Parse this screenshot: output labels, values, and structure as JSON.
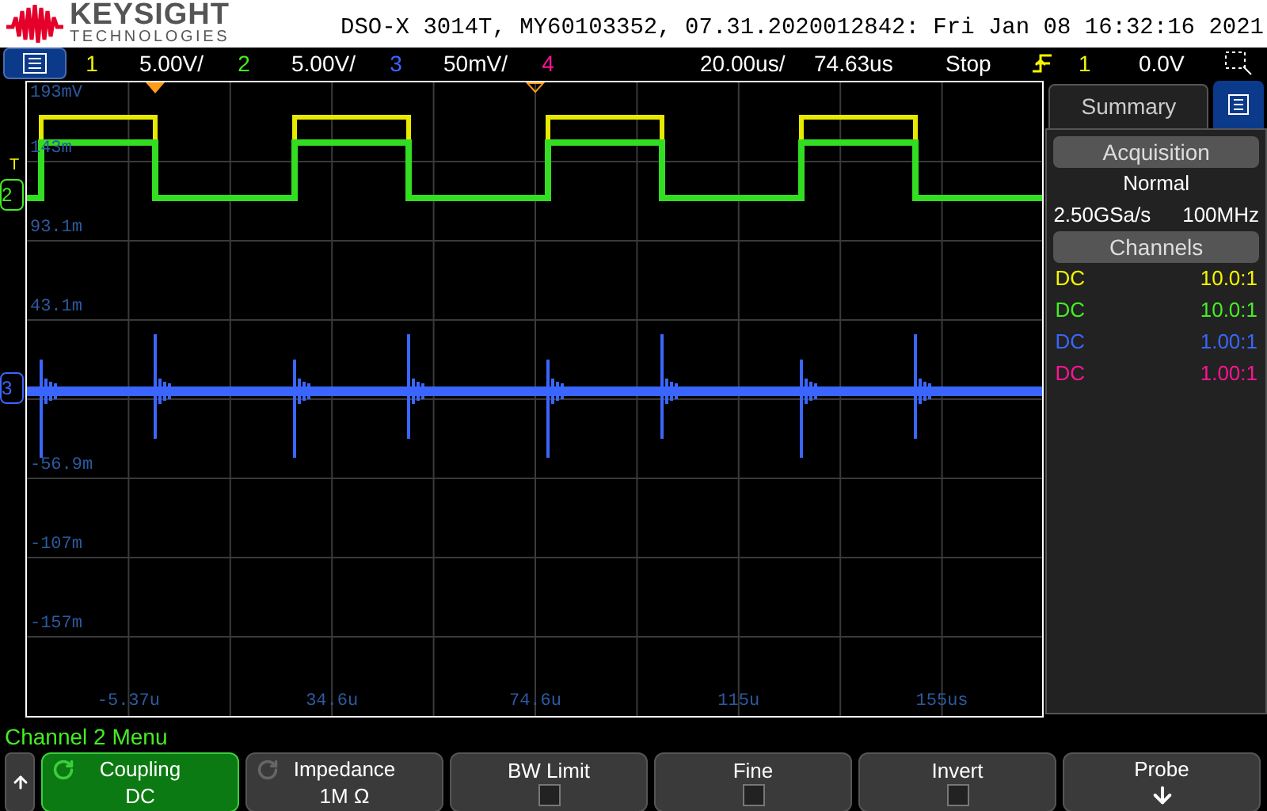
{
  "header": {
    "brand": "KEYSIGHT",
    "brand_sub": "TECHNOLOGIES",
    "title": "DSO-X 3014T, MY60103352, 07.31.2020012842: Fri Jan 08 16:32:16 2021"
  },
  "status_bar": {
    "channels": [
      {
        "number": "1",
        "scale": "5.00V/"
      },
      {
        "number": "2",
        "scale": "5.00V/"
      },
      {
        "number": "3",
        "scale": "50mV/"
      },
      {
        "number": "4"
      }
    ],
    "timebase": "20.00us/",
    "delay": "74.63us",
    "run_state": "Stop",
    "trigger": {
      "source": "1",
      "level": "0.0V"
    }
  },
  "graticule": {
    "y_labels": [
      "193mV",
      "143m",
      "93.1m",
      "43.1m",
      "-56.9m",
      "-107m",
      "-157m"
    ],
    "x_labels": [
      "-5.37u",
      "34.6u",
      "74.6u",
      "115u",
      "155us"
    ],
    "markers": [
      {
        "label": "T",
        "kind": "trigger"
      },
      {
        "label": "2",
        "kind": "channel",
        "color": "#44ee22"
      },
      {
        "label": "3",
        "kind": "channel",
        "color": "#3a66ff"
      }
    ]
  },
  "summary": {
    "tab": "Summary",
    "acquisition": {
      "heading": "Acquisition",
      "mode": "Normal",
      "sample_rate": "2.50GSa/s",
      "bandwidth": "100MHz"
    },
    "channels": {
      "heading": "Channels",
      "rows": [
        {
          "coupling": "DC",
          "probe": "10.0:1",
          "color": "#f5f500"
        },
        {
          "coupling": "DC",
          "probe": "10.0:1",
          "color": "#44ee22"
        },
        {
          "coupling": "DC",
          "probe": "1.00:1",
          "color": "#3a66ff"
        },
        {
          "coupling": "DC",
          "probe": "1.00:1",
          "color": "#ff1493"
        }
      ]
    }
  },
  "menu": {
    "title": "Channel 2 Menu",
    "softkeys": [
      {
        "kind": "knob",
        "label": "Coupling",
        "value": "DC",
        "selected": true
      },
      {
        "kind": "knob",
        "label": "Impedance",
        "value": "1M Ω",
        "selected": false
      },
      {
        "kind": "checkbox",
        "label": "BW Limit",
        "checked": false,
        "selected": false
      },
      {
        "kind": "checkbox",
        "label": "Fine",
        "checked": false,
        "selected": false
      },
      {
        "kind": "checkbox",
        "label": "Invert",
        "checked": false,
        "selected": false
      },
      {
        "kind": "submenu",
        "label": "Probe",
        "selected": false
      }
    ]
  }
}
